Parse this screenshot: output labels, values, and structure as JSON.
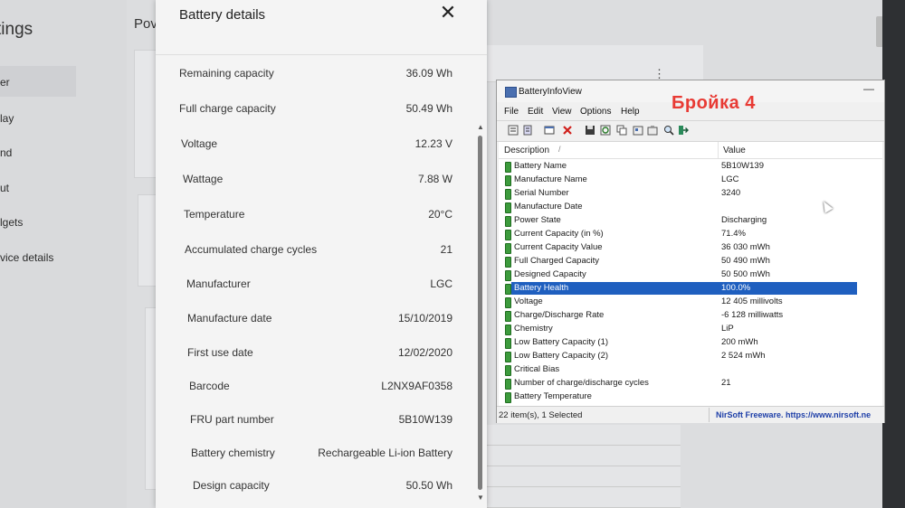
{
  "background": {
    "title": "tings",
    "power_label": "Pov",
    "nav": [
      "er",
      "lay",
      "nd",
      "ut",
      "lgets",
      "vice details"
    ],
    "dots": "⋮"
  },
  "panel": {
    "title": "Battery details",
    "close": "✕",
    "rows": [
      {
        "label": "Remaining capacity",
        "value": "36.09 Wh"
      },
      {
        "label": "Full charge capacity",
        "value": "50.49 Wh"
      },
      {
        "label": "Voltage",
        "value": "12.23 V"
      },
      {
        "label": "Wattage",
        "value": "7.88 W"
      },
      {
        "label": "Temperature",
        "value": "20°C"
      },
      {
        "label": "Accumulated charge cycles",
        "value": "21"
      },
      {
        "label": "Manufacturer",
        "value": "LGC"
      },
      {
        "label": "Manufacture date",
        "value": "15/10/2019"
      },
      {
        "label": "First use date",
        "value": "12/02/2020"
      },
      {
        "label": "Barcode",
        "value": "L2NX9AF0358"
      },
      {
        "label": "FRU part number",
        "value": "5B10W139"
      },
      {
        "label": "Battery chemistry",
        "value": "Rechargeable Li-ion Battery"
      },
      {
        "label": "Design capacity",
        "value": "50.50 Wh"
      }
    ]
  },
  "biv": {
    "title": "BatteryInfoView",
    "overlay_text": "Бройка 4",
    "minimize": "—",
    "menu": [
      "File",
      "Edit",
      "View",
      "Options",
      "Help"
    ],
    "col_description": "Description",
    "col_value": "Value",
    "sort_indicator": "/",
    "rows": [
      {
        "label": "Battery Name",
        "value": "5B10W139"
      },
      {
        "label": "Manufacture Name",
        "value": "LGC"
      },
      {
        "label": "Serial Number",
        "value": "3240"
      },
      {
        "label": "Manufacture Date",
        "value": ""
      },
      {
        "label": "Power State",
        "value": "Discharging"
      },
      {
        "label": "Current Capacity (in %)",
        "value": "71.4%"
      },
      {
        "label": "Current Capacity Value",
        "value": "36 030 mWh"
      },
      {
        "label": "Full Charged Capacity",
        "value": "50 490 mWh"
      },
      {
        "label": "Designed Capacity",
        "value": "50 500 mWh"
      },
      {
        "label": "Battery Health",
        "value": "100.0%"
      },
      {
        "label": "Voltage",
        "value": "12 405 millivolts"
      },
      {
        "label": "Charge/Discharge Rate",
        "value": "-6 128 milliwatts"
      },
      {
        "label": "Chemistry",
        "value": "LiP"
      },
      {
        "label": "Low Battery Capacity (1)",
        "value": "200 mWh"
      },
      {
        "label": "Low Battery Capacity (2)",
        "value": "2 524 mWh"
      },
      {
        "label": "Critical Bias",
        "value": ""
      },
      {
        "label": "Number of charge/discharge cycles",
        "value": "21"
      },
      {
        "label": "Battery Temperature",
        "value": ""
      }
    ],
    "status_left": "22 item(s), 1 Selected",
    "status_right": "NirSoft Freeware. https://www.nirsoft.ne"
  }
}
